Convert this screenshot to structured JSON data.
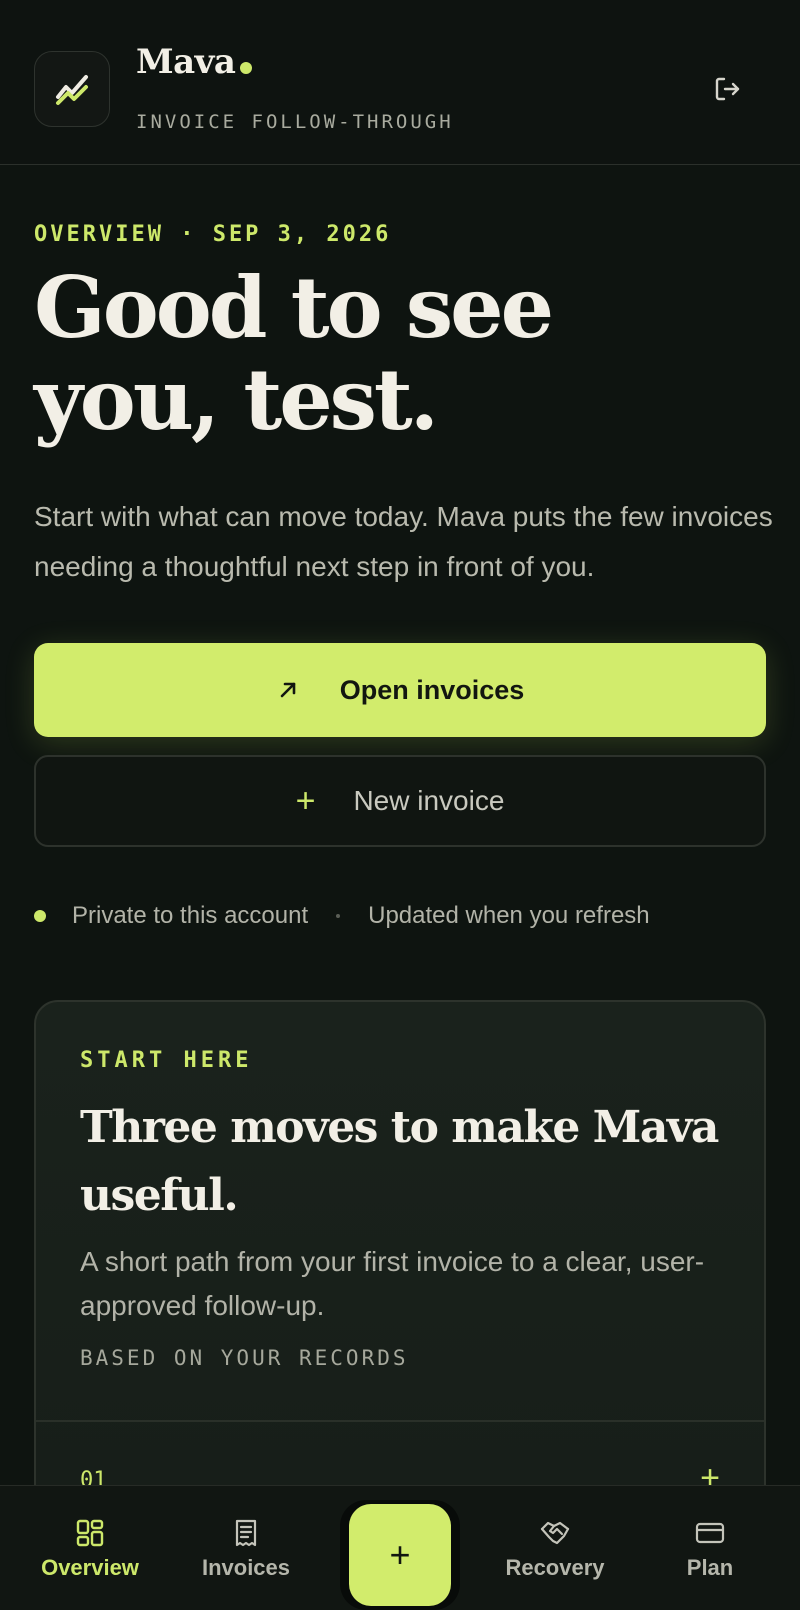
{
  "header": {
    "brand": "Mava",
    "tagline": "INVOICE FOLLOW-THROUGH",
    "logo_icon": "chart-check-logo-icon",
    "logout_icon": "logout-icon"
  },
  "hero": {
    "eyebrow": "OVERVIEW · SEP 3, 2026",
    "headline": "Good to see you, test.",
    "intro": "Start with what can move today. Mava puts the few invoices needing a thoughtful next step in front of you."
  },
  "actions": {
    "primary_label": "Open invoices",
    "primary_icon": "arrow-up-right-icon",
    "secondary_label": "New invoice",
    "secondary_icon": "plus-icon"
  },
  "meta": {
    "privacy": "Private to this account",
    "refresh": "Updated when you refresh"
  },
  "start_card": {
    "eyebrow": "START HERE",
    "title": "Three moves to make Mava useful.",
    "description": "A short path from your first invoice to a clear, user-approved follow-up.",
    "meta": "BASED ON YOUR RECORDS",
    "first_step_number": "01",
    "add_glyph": "+"
  },
  "nav": {
    "items": [
      {
        "label": "Overview",
        "icon": "grid-icon",
        "active": true
      },
      {
        "label": "Invoices",
        "icon": "receipt-icon",
        "active": false
      },
      {
        "label": "Recovery",
        "icon": "handshake-icon",
        "active": false
      },
      {
        "label": "Plan",
        "icon": "credit-card-icon",
        "active": false
      }
    ],
    "fab_glyph": "+"
  },
  "colors": {
    "background": "#0e1410",
    "accent": "#d2ec6c",
    "text": "#f2efe6",
    "muted": "#b2b3a8"
  }
}
